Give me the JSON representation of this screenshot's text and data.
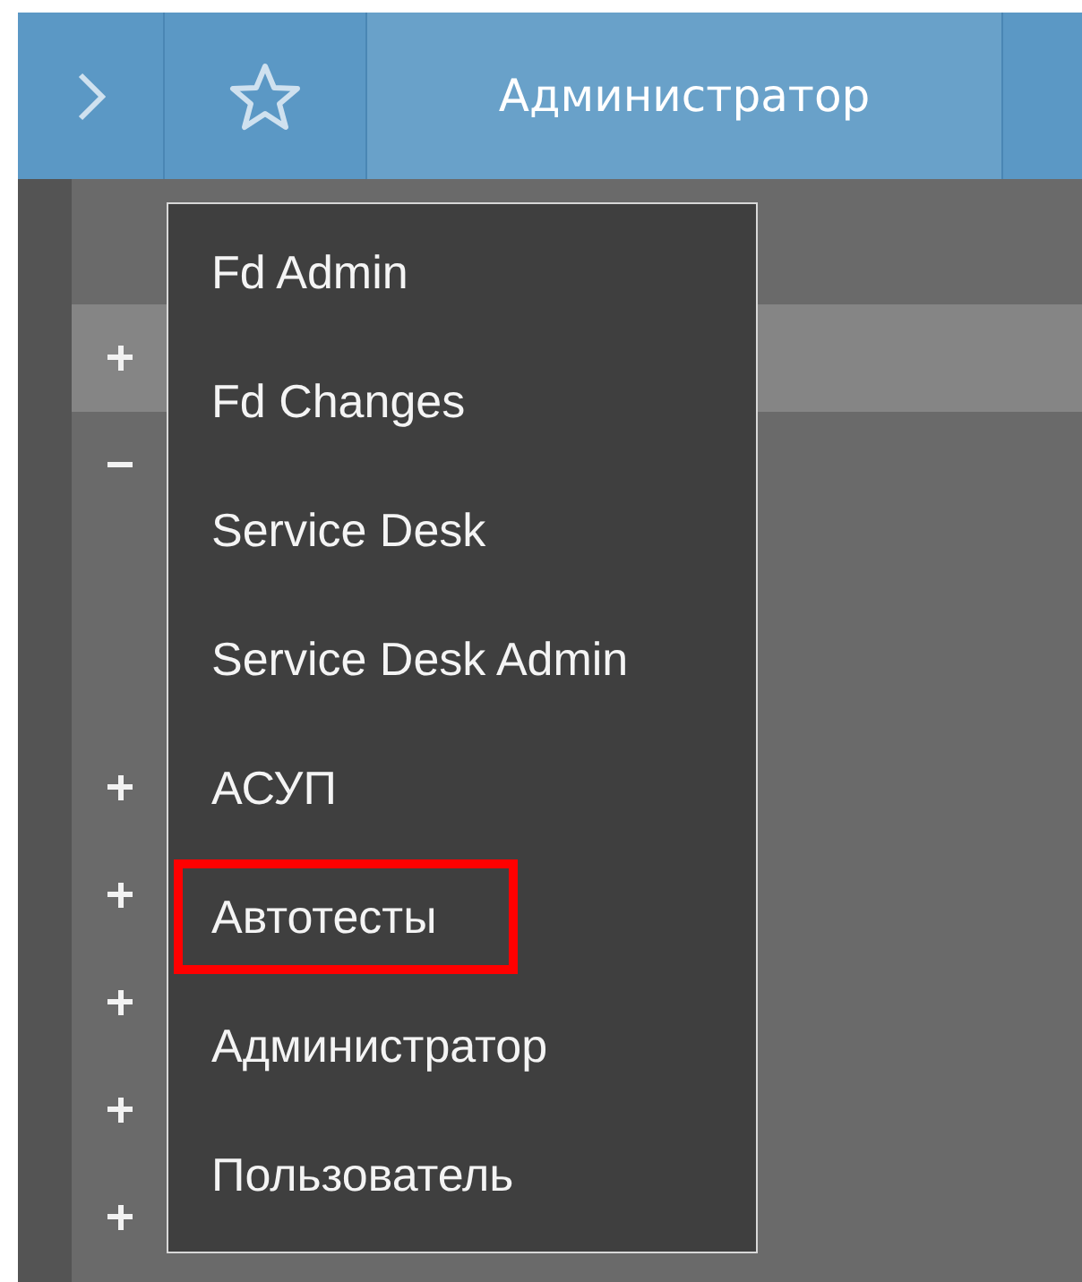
{
  "header": {
    "tabs": [
      {
        "label": "Администратор",
        "selected": true
      }
    ]
  },
  "tree": {
    "rows": [
      {
        "expanded": false,
        "selected": true
      },
      {
        "expanded": true,
        "selected": false
      },
      {
        "expanded": false,
        "selected": false
      },
      {
        "expanded": false,
        "selected": false
      },
      {
        "expanded": false,
        "selected": false
      },
      {
        "expanded": false,
        "selected": false
      },
      {
        "expanded": false,
        "selected": false
      }
    ]
  },
  "menu": {
    "items": [
      {
        "label": "Fd Admin",
        "highlighted": false
      },
      {
        "label": "Fd Changes",
        "highlighted": false
      },
      {
        "label": "Service Desk",
        "highlighted": false
      },
      {
        "label": "Service Desk Admin",
        "highlighted": false
      },
      {
        "label": "АСУП",
        "highlighted": false
      },
      {
        "label": "Автотесты",
        "highlighted": true
      },
      {
        "label": "Администратор",
        "highlighted": false
      },
      {
        "label": "Пользователь",
        "highlighted": false
      }
    ]
  }
}
